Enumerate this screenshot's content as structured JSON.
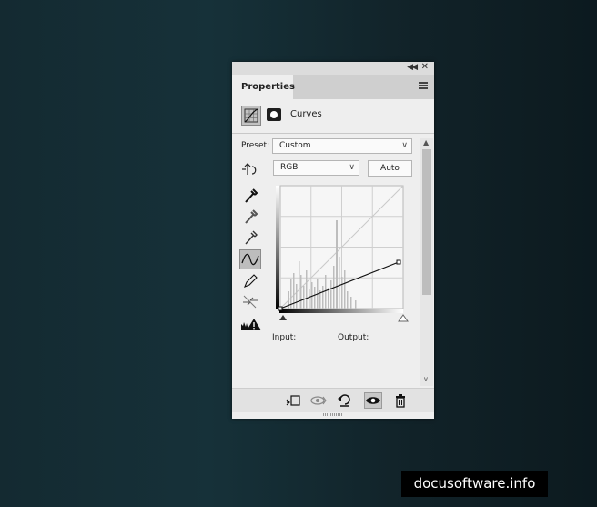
{
  "panel": {
    "tab_label": "Properties",
    "adjustment_label": "Curves",
    "preset_label": "Preset:",
    "preset_value": "Custom",
    "channel_value": "RGB",
    "auto_label": "Auto",
    "input_label": "Input:",
    "output_label": "Output:"
  },
  "icons": {
    "collapse": "double-chevron-left-icon",
    "close": "close-icon",
    "menu": "hamburger-menu-icon"
  },
  "colors": {
    "panel_bg": "#eeeeee",
    "active_tool": "#bdbdbd",
    "curve": "#111111"
  },
  "watermark": "docusoftware.info"
}
